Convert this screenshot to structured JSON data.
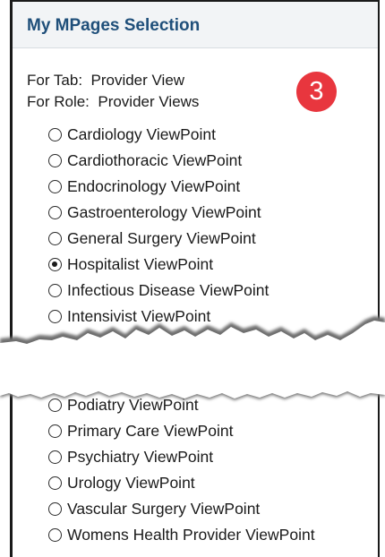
{
  "panel": {
    "title": "My MPages Selection",
    "tab_line": "For Tab:  Provider View",
    "role_line": "For Role:  Provider Views",
    "step_badge": "3"
  },
  "options_top": [
    {
      "label": "Cardiology ViewPoint",
      "selected": false
    },
    {
      "label": "Cardiothoracic ViewPoint",
      "selected": false
    },
    {
      "label": "Endocrinology ViewPoint",
      "selected": false
    },
    {
      "label": "Gastroenterology ViewPoint",
      "selected": false
    },
    {
      "label": "General Surgery ViewPoint",
      "selected": false
    },
    {
      "label": "Hospitalist ViewPoint",
      "selected": true
    },
    {
      "label": "Infectious Disease ViewPoint",
      "selected": false
    },
    {
      "label": "Intensivist ViewPoint",
      "selected": false
    }
  ],
  "options_bottom": [
    {
      "label": "Podiatry ViewPoint",
      "selected": false
    },
    {
      "label": "Primary Care ViewPoint",
      "selected": false
    },
    {
      "label": "Psychiatry ViewPoint",
      "selected": false
    },
    {
      "label": "Urology ViewPoint",
      "selected": false
    },
    {
      "label": "Vascular Surgery ViewPoint",
      "selected": false
    },
    {
      "label": "Womens Health Provider ViewPoint",
      "selected": false
    }
  ],
  "colors": {
    "title": "#1f4f7a",
    "header_bg": "#f2f4f6",
    "badge": "#e8363e"
  },
  "icons": {
    "radio": "radio-button-icon",
    "tear": "torn-paper-edge"
  }
}
